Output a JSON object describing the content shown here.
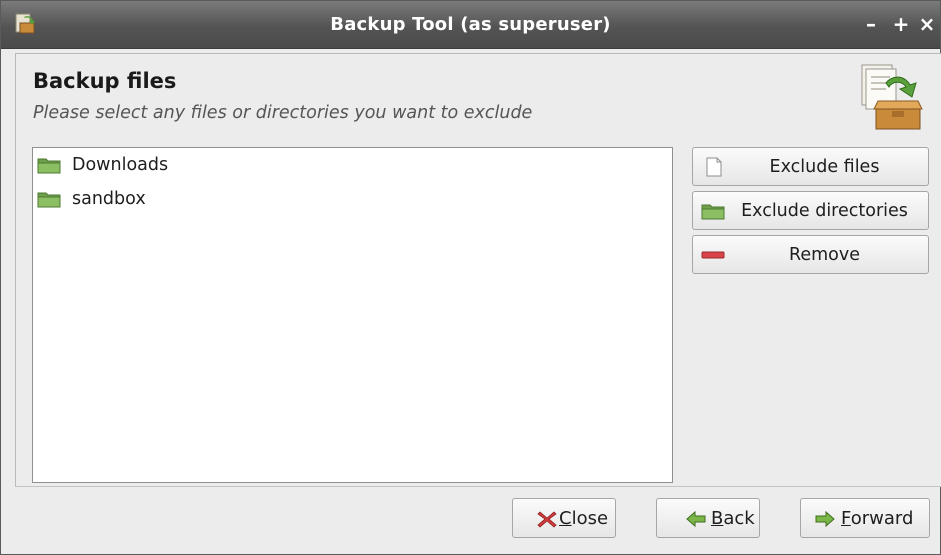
{
  "window": {
    "title": "Backup Tool (as superuser)",
    "controls": {
      "minimize": "–",
      "maximize": "+",
      "close": "×"
    }
  },
  "header": {
    "title": "Backup files",
    "subtitle": "Please select any files or directories you want to exclude",
    "icon": "backup-box-icon"
  },
  "list": {
    "items": [
      {
        "label": "Downloads",
        "icon": "folder-icon"
      },
      {
        "label": "sandbox",
        "icon": "folder-icon"
      }
    ]
  },
  "actions": {
    "exclude_files": {
      "label": "Exclude files",
      "icon": "file-icon"
    },
    "exclude_dirs": {
      "label": "Exclude directories",
      "icon": "folder-icon"
    },
    "remove": {
      "label": "Remove",
      "icon": "remove-icon"
    }
  },
  "footer": {
    "close": {
      "mnemonic": "C",
      "rest": "lose",
      "icon": "close-x-icon"
    },
    "back": {
      "mnemonic": "B",
      "rest": "ack",
      "icon": "back-arrow-icon"
    },
    "forward": {
      "mnemonic": "F",
      "rest": "orward",
      "icon": "forward-arrow-icon"
    }
  },
  "colors": {
    "titlebar": "#545454",
    "folder": "#7fae5a",
    "remove": "#d9444a",
    "close_x": "#d23c3c",
    "arrow": "#6fa33a"
  }
}
